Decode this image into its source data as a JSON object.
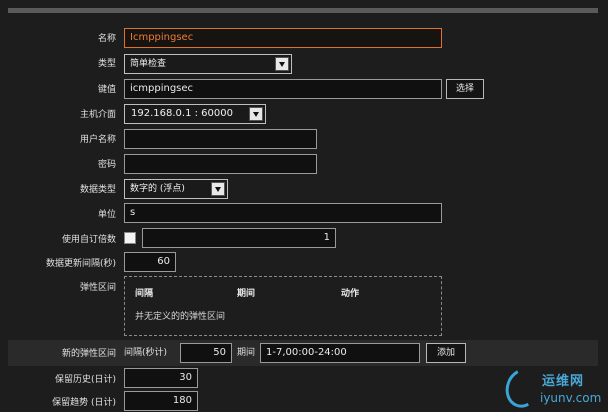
{
  "form": {
    "name": {
      "label": "名称",
      "value": "Icmppingsec"
    },
    "type": {
      "label": "类型",
      "value": "简单检查"
    },
    "key": {
      "label": "键值",
      "value": "icmppingsec",
      "button": "选择"
    },
    "host_interface": {
      "label": "主机介面",
      "value": "192.168.0.1 : 60000"
    },
    "username": {
      "label": "用户名称",
      "value": ""
    },
    "password": {
      "label": "密码",
      "value": ""
    },
    "data_type": {
      "label": "数据类型",
      "value": "数字的 (浮点)"
    },
    "units": {
      "label": "单位",
      "value": "s"
    },
    "multiplier": {
      "label": "使用自订倍数",
      "value": "1"
    },
    "update_interval": {
      "label": "数据更新间隔(秒)",
      "value": "60"
    },
    "flexible_intervals": {
      "label": "弹性区间",
      "col_interval": "间隔",
      "col_period": "期间",
      "col_action": "动作",
      "empty": "并无定义的的弹性区间"
    },
    "new_flexible_interval": {
      "label": "新的弹性区间",
      "interval_label": "间隔(秒计)",
      "interval_value": "50",
      "period_label": "期间",
      "period_value": "1-7,00:00-24:00",
      "add_button": "添加"
    },
    "history": {
      "label": "保留历史(日计)",
      "value": "30"
    },
    "trends": {
      "label": "保留趋势 (日计)",
      "value": "180"
    }
  },
  "watermark": {
    "cn": "运维网",
    "en": "iyunv.com"
  },
  "colors": {
    "focus_border": "#e0702a",
    "logo": "#4aa7d8"
  }
}
